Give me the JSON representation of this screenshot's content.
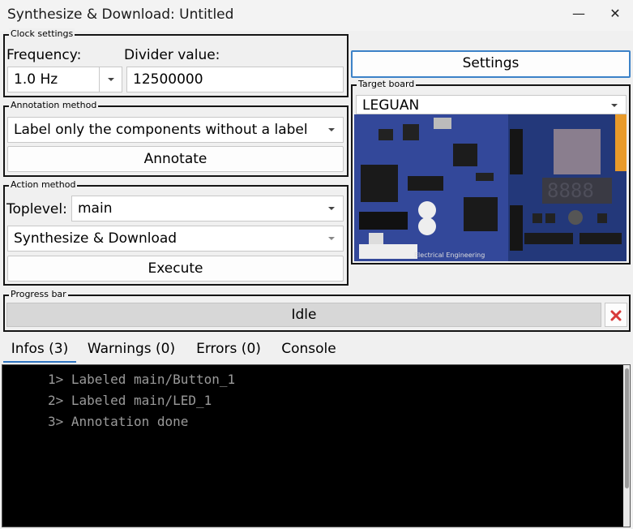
{
  "window": {
    "title": "Synthesize & Download: Untitled",
    "minimize_glyph": "—",
    "close_glyph": "✕"
  },
  "clock": {
    "group_label": "Clock settings",
    "frequency_label": "Frequency:",
    "frequency_value": "1.0 Hz",
    "divider_label": "Divider value:",
    "divider_value": "12500000"
  },
  "annotation": {
    "group_label": "Annotation method",
    "method_value": "Label only the components without a label",
    "annotate_label": "Annotate"
  },
  "action": {
    "group_label": "Action method",
    "toplevel_label": "Toplevel:",
    "toplevel_value": "main",
    "action_value": "Synthesize & Download",
    "execute_label": "Execute"
  },
  "settings": {
    "button_label": "Settings"
  },
  "target": {
    "group_label": "Target board",
    "board_value": "LEGUAN",
    "board_text": "Electrical Engineering"
  },
  "progress": {
    "group_label": "Progress bar",
    "status": "Idle",
    "cancel_icon": "close-icon"
  },
  "tabs": [
    {
      "label": "Infos (3)",
      "active": true
    },
    {
      "label": "Warnings (0)",
      "active": false
    },
    {
      "label": "Errors (0)",
      "active": false
    },
    {
      "label": "Console",
      "active": false
    }
  ],
  "console": {
    "lines": [
      "1> Labeled main/Button_1",
      "2> Labeled main/LED_1",
      "3> Annotation done"
    ]
  },
  "colors": {
    "accent": "#3c82c8",
    "cancel_red": "#d83a3a",
    "console_bg": "#000000",
    "console_text": "#9a9a9a"
  }
}
